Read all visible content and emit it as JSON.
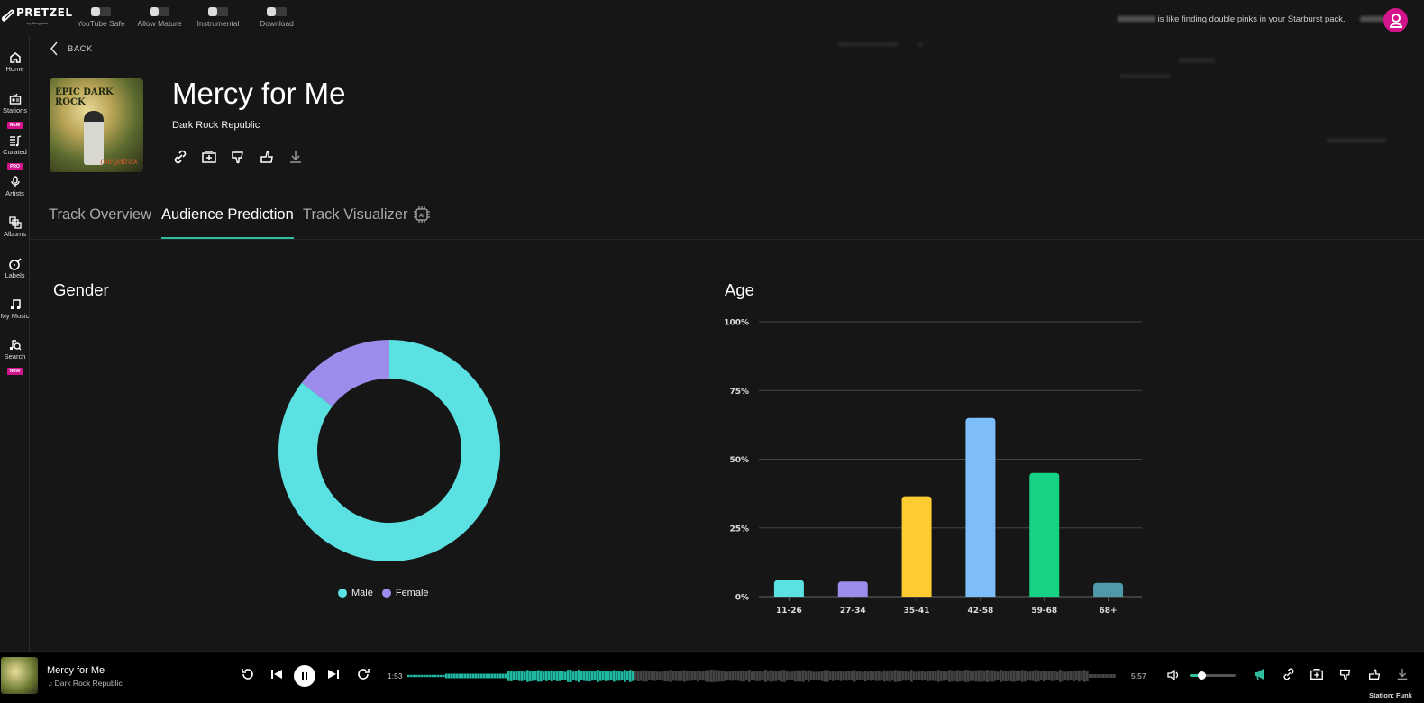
{
  "app": {
    "logo_text": "PRETZEL",
    "logo_sub": "by Songtradr",
    "toggles": [
      {
        "label": "YouTube Safe",
        "on": false
      },
      {
        "label": "Allow Mature",
        "on": false
      },
      {
        "label": "Instrumental",
        "on": false
      },
      {
        "label": "Download",
        "on": false
      }
    ],
    "tagline": "is like finding double pinks in your Starburst pack.",
    "avatar_icon": "user-icon",
    "accent_color": "#2fbf9f",
    "brand_color": "#d4148c"
  },
  "sidebar": {
    "items": [
      {
        "label": "Home",
        "icon": "home-icon",
        "badge": ""
      },
      {
        "label": "Stations",
        "icon": "radio-icon",
        "badge": "NEW"
      },
      {
        "label": "Curated",
        "icon": "playlist-icon",
        "badge": "PRO"
      },
      {
        "label": "Artists",
        "icon": "microphone-icon",
        "badge": ""
      },
      {
        "label": "Albums",
        "icon": "albums-icon",
        "badge": ""
      },
      {
        "label": "Labels",
        "icon": "label-icon",
        "badge": ""
      },
      {
        "label": "My Music",
        "icon": "music-note-icon",
        "badge": ""
      },
      {
        "label": "Search",
        "icon": "search-music-icon",
        "badge": "NEW"
      }
    ]
  },
  "track": {
    "back_label": "BACK",
    "title": "Mercy for Me",
    "artist": "Dark Rock Republic",
    "cover_text_top": "EPIC DARK ROCK",
    "cover_text_bottom": "megatrax",
    "actions": [
      "link-icon",
      "add-to-playlist-icon",
      "dislike-icon",
      "like-icon",
      "download-icon"
    ]
  },
  "tabs": [
    {
      "label": "Track Overview",
      "active": false
    },
    {
      "label": "Audience Prediction",
      "active": true
    },
    {
      "label": "Track Visualizer",
      "active": false
    }
  ],
  "ai_badge": "AI",
  "chart_data": [
    {
      "type": "pie",
      "title": "Gender",
      "donut": true,
      "categories": [
        "Male",
        "Female"
      ],
      "values": [
        85.5,
        14.5
      ],
      "colors": [
        "#5ce1e2",
        "#9e8ced"
      ],
      "legend": "bottom"
    },
    {
      "type": "bar",
      "title": "Age",
      "xlabel": "",
      "ylabel": "",
      "categories": [
        "11-26",
        "27-34",
        "35-41",
        "42-58",
        "59-68",
        "68+"
      ],
      "values": [
        6,
        5.5,
        36.5,
        65,
        45,
        5
      ],
      "colors": [
        "#5ce1e2",
        "#9e8ced",
        "#fecb31",
        "#7dbdf9",
        "#15d383",
        "#4e9aaa"
      ],
      "ylim": [
        0,
        100
      ],
      "yticks": [
        "0%",
        "25%",
        "50%",
        "75%",
        "100%"
      ],
      "grid": true
    }
  ],
  "player": {
    "title": "Mercy for Me",
    "artist": "Dark Rock Republic",
    "elapsed": "1:53",
    "duration": "5:57",
    "progress": 0.317,
    "volume": 0.25,
    "station": "Station: Funk"
  }
}
